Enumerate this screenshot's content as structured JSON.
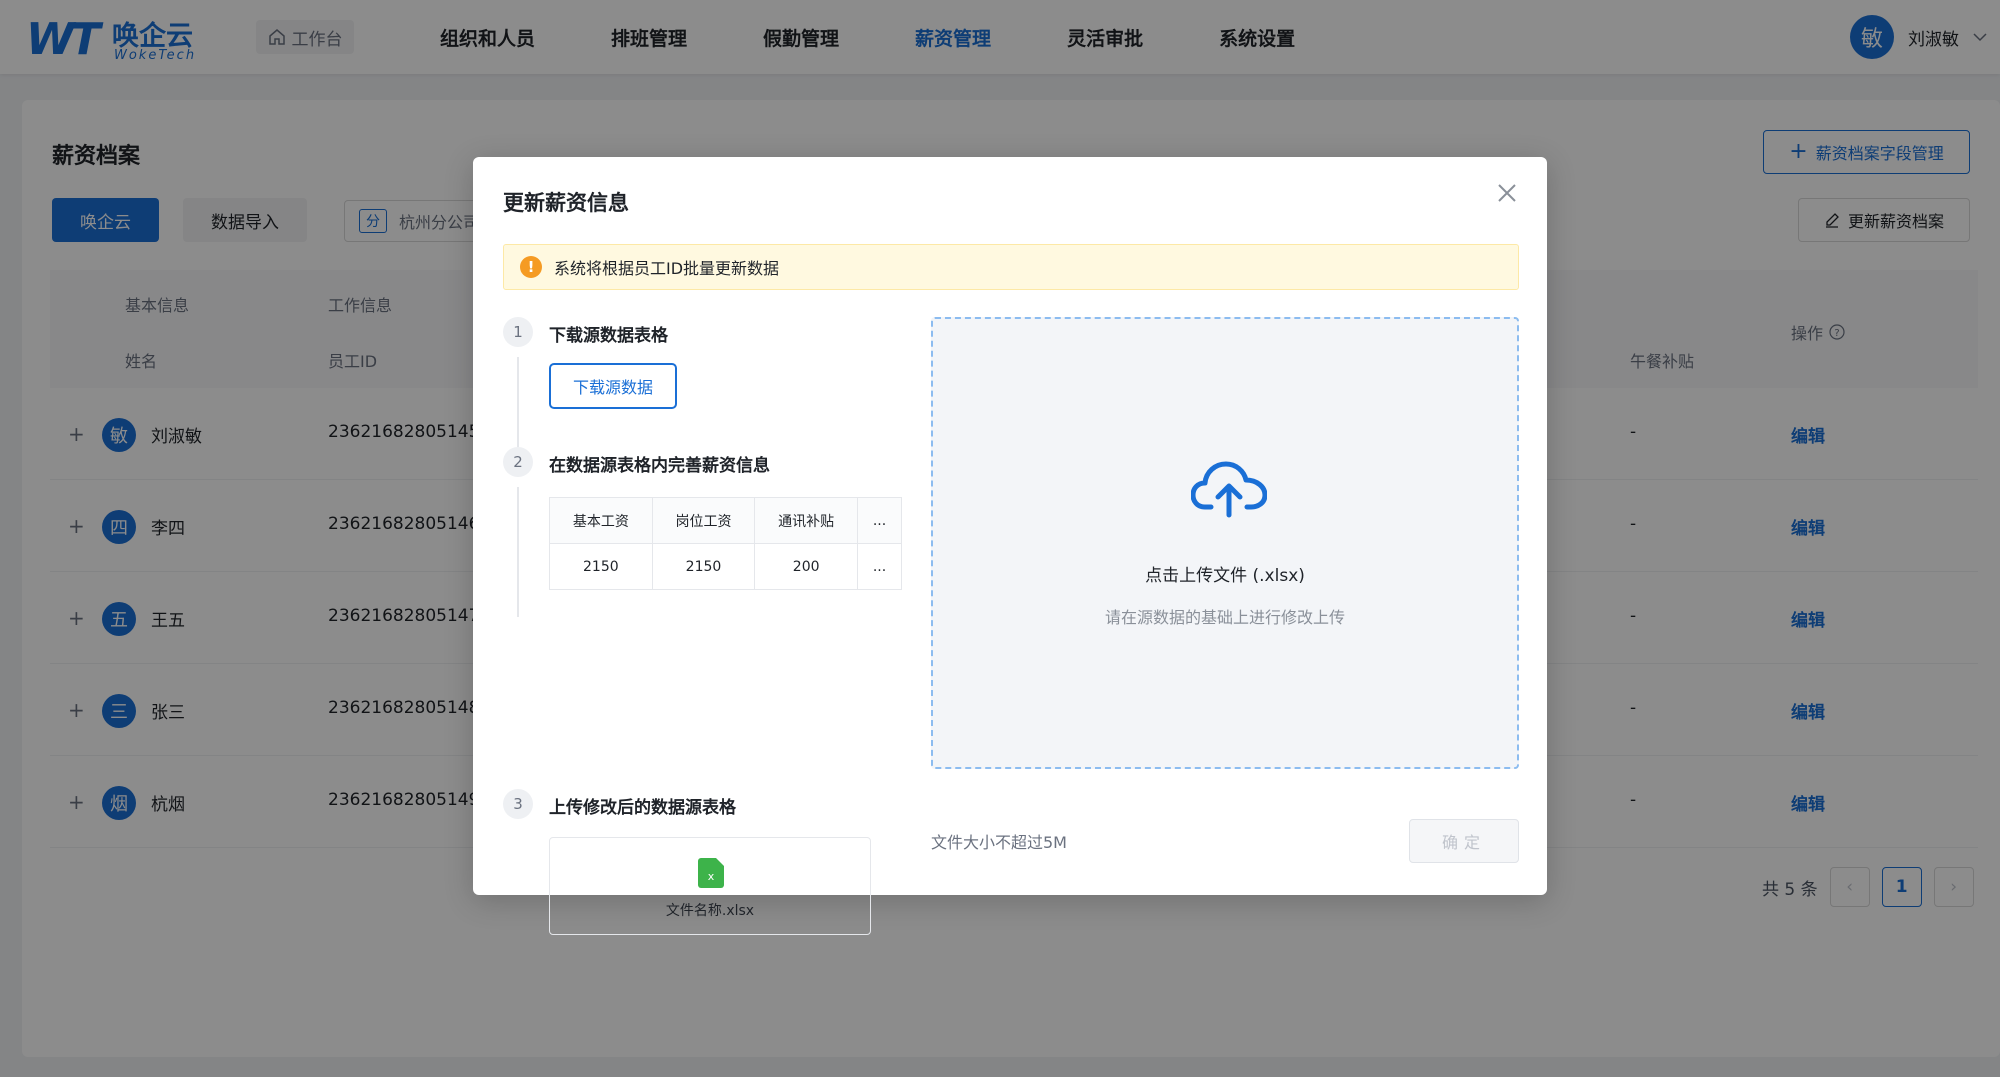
{
  "app": {
    "logo_mark": "WT",
    "logo_cn": "唤企云",
    "logo_en": "WokeTech",
    "workbench_label": "工作台"
  },
  "nav": {
    "items": [
      "组织和人员",
      "排班管理",
      "假勤管理",
      "薪资管理",
      "灵活审批",
      "系统设置"
    ],
    "active": "薪资管理"
  },
  "user": {
    "avatar_char": "敏",
    "name": "刘淑敏"
  },
  "page": {
    "title": "薪资档案",
    "field_manage_label": "薪资档案字段管理",
    "tabs": [
      "唤企云",
      "数据导入"
    ],
    "org_tag": "分",
    "org_name": "杭州分公司",
    "update_archive_label": "更新薪资档案"
  },
  "table": {
    "group_headers": [
      "基本信息",
      "工作信息"
    ],
    "columns": [
      "姓名",
      "员工ID",
      "午餐补贴"
    ],
    "operation_header": "操作",
    "rows": [
      {
        "avatar": "敏",
        "name": "刘淑敏",
        "id": "23621682805145",
        "lunch": "-",
        "action": "编辑"
      },
      {
        "avatar": "四",
        "name": "李四",
        "id": "23621682805146",
        "lunch": "-",
        "action": "编辑"
      },
      {
        "avatar": "五",
        "name": "王五",
        "id": "23621682805147",
        "lunch": "-",
        "action": "编辑"
      },
      {
        "avatar": "三",
        "name": "张三",
        "id": "23621682805148",
        "lunch": "-",
        "action": "编辑"
      },
      {
        "avatar": "烟",
        "name": "杭烟",
        "id": "23621682805149",
        "lunch": "-",
        "action": "编辑"
      }
    ]
  },
  "pagination": {
    "total_text": "共 5 条",
    "current_page": "1"
  },
  "modal": {
    "title": "更新薪资信息",
    "notice": "系统将根据员工ID批量更新数据",
    "step1": {
      "no": "1",
      "label": "下载源数据表格",
      "button": "下载源数据"
    },
    "step2": {
      "no": "2",
      "label": "在数据源表格内完善薪资信息",
      "headers": [
        "基本工资",
        "岗位工资",
        "通讯补贴",
        "..."
      ],
      "values": [
        "2150",
        "2150",
        "200",
        "..."
      ]
    },
    "step3": {
      "no": "3",
      "label": "上传修改后的数据源表格",
      "file_badge": "x",
      "file_name": "文件名称.xlsx"
    },
    "upload": {
      "text": "点击上传文件 (.xlsx)",
      "hint": "请在源数据的基础上进行修改上传"
    },
    "size_note": "文件大小不超过5M",
    "confirm_label": "确定"
  },
  "colors": {
    "brand": "#1a6fd6",
    "warning": "#f59b23",
    "excel": "#3db34a"
  }
}
